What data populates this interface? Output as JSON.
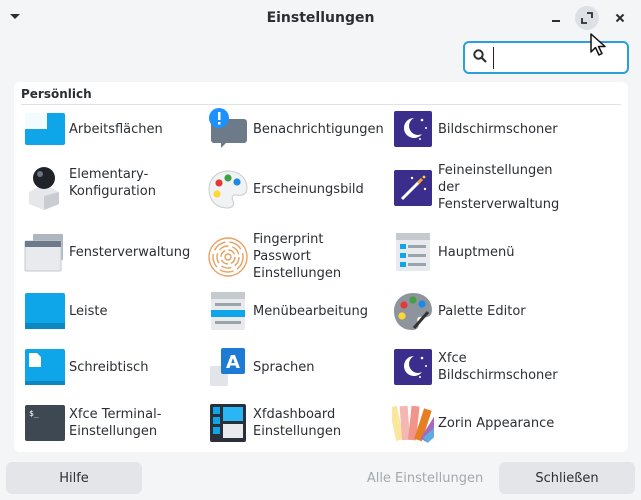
{
  "window": {
    "title": "Einstellungen",
    "menu_icon": "chevron-down-icon",
    "buttons": [
      "minimize-icon",
      "maximize-icon",
      "close-icon"
    ]
  },
  "search": {
    "value": "",
    "icon": "search-icon",
    "accent": "#2a9fd8"
  },
  "section": {
    "title": "Persönlich"
  },
  "items": [
    {
      "label": "Arbeitsflächen",
      "icon": "workspaces-icon"
    },
    {
      "label": "Benachrichtigungen",
      "icon": "notifications-icon"
    },
    {
      "label": "Bildschirmschoner",
      "icon": "screensaver-icon"
    },
    {
      "label": "Elementary-\nKonfiguration",
      "icon": "elementary-icon"
    },
    {
      "label": "Erscheinungsbild",
      "icon": "appearance-palette-icon"
    },
    {
      "label": "Feineinstellungen\nder\nFensterverwaltung",
      "icon": "magic-wand-icon"
    },
    {
      "label": "Fensterverwaltung",
      "icon": "window-manager-icon"
    },
    {
      "label": "Fingerprint\nPasswort\nEinstellungen",
      "icon": "fingerprint-icon"
    },
    {
      "label": "Hauptmenü",
      "icon": "main-menu-icon"
    },
    {
      "label": "Leiste",
      "icon": "panel-icon"
    },
    {
      "label": "Menübearbeitung",
      "icon": "menu-editor-icon"
    },
    {
      "label": "Palette Editor",
      "icon": "palette-editor-icon"
    },
    {
      "label": "Schreibtisch",
      "icon": "desktop-icon"
    },
    {
      "label": "Sprachen",
      "icon": "language-icon"
    },
    {
      "label": "Xfce\nBildschirmschoner",
      "icon": "xfce-screensaver-icon"
    },
    {
      "label": "Xfce Terminal-\nEinstellungen",
      "icon": "terminal-icon"
    },
    {
      "label": "Xfdashboard\nEinstellungen",
      "icon": "xfdashboard-icon"
    },
    {
      "label": "Zorin Appearance",
      "icon": "zorin-appearance-icon"
    }
  ],
  "footer": {
    "help_label": "Hilfe",
    "all_label": "Alle Einstellungen",
    "close_label": "Schließen"
  },
  "colors": {
    "blue": "#0ea5e9",
    "dark_purple": "#3b2d8c",
    "accent": "#2a9fd8"
  }
}
